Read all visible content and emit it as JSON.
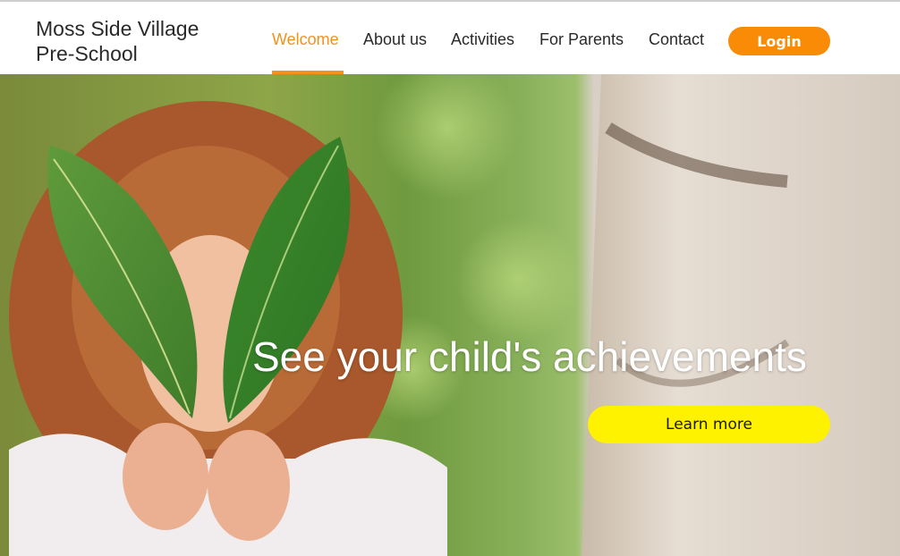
{
  "header": {
    "brand_line1": "Moss Side Village",
    "brand_line2": "Pre-School",
    "nav": [
      {
        "label": "Welcome",
        "active": true
      },
      {
        "label": "About us",
        "active": false
      },
      {
        "label": "Activities",
        "active": false
      },
      {
        "label": "For Parents",
        "active": false
      },
      {
        "label": "Contact",
        "active": false
      }
    ],
    "login_label": "Login"
  },
  "hero": {
    "headline": "See your child's achievements",
    "cta_label": "Learn more",
    "image_subject": "child holding two leaves in front of face"
  },
  "colors": {
    "accent": "#f5901e",
    "login_bg": "#f98b06",
    "cta_bg": "#fff200",
    "text": "#2a2a2a"
  }
}
